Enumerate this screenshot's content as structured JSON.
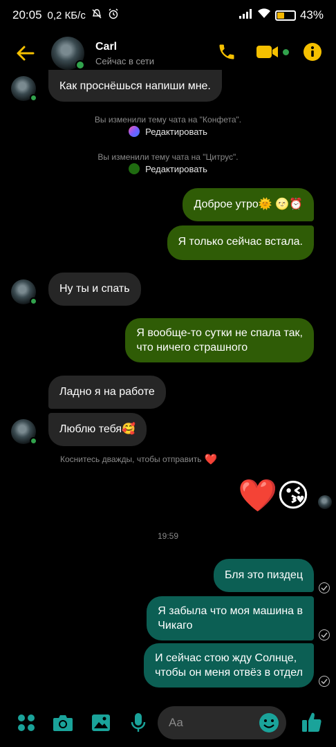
{
  "status_bar": {
    "time": "20:05",
    "speed": "0,2 КБ/с",
    "battery_percent": "43%",
    "battery_level": 0.43
  },
  "header": {
    "contact_name": "Carl",
    "contact_status": "Сейчас в сети"
  },
  "colors": {
    "accent": "#f5c000",
    "incoming_bubble": "#262626",
    "outgoing_green": "#2f5c06",
    "outgoing_teal": "#0c5f54",
    "online": "#31a24c"
  },
  "messages": {
    "m1": "Как проснёшься напиши мне.",
    "sys1_text": "Вы изменили тему чата на \"Конфета\".",
    "sys1_edit": "Редактировать",
    "sys2_text": "Вы изменили тему чата на \"Цитрус\".",
    "sys2_edit": "Редактировать",
    "m2": "Доброе утро🌞 🌝⏰",
    "m3": "Я только сейчас встала.",
    "m4": "Ну ты и спать",
    "m5_line1": "Я вообще-то сутки не спала так,",
    "m5_line2": "что ничего страшного",
    "m6": "Ладно я на работе",
    "m7": "Люблю тебя🥰",
    "hint": "Коснитесь дважды, чтобы отправить",
    "hint_emoji": "❤️",
    "emoji_heart": "❤️",
    "emoji_kiss": "😘",
    "timestamp": "19:59",
    "m8": "Бля это пиздец",
    "m9_line1": "Я забыла что моя машина в",
    "m9_line2": "Чикаго",
    "m10_line1": "И сейчас стою жду Солнце,",
    "m10_line2": "чтобы он меня отвёз в отдел"
  },
  "composer": {
    "placeholder": "Aa"
  }
}
